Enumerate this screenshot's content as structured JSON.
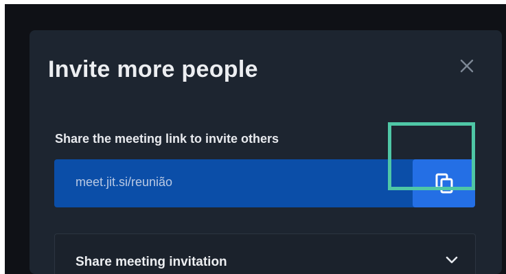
{
  "dialog": {
    "title": "Invite more people",
    "close_icon": "close-icon",
    "share_link": {
      "label": "Share the meeting link to invite others",
      "url": "meet.jit.si/reunião",
      "copy_icon": "copy-icon"
    },
    "invitation": {
      "label": "Share meeting invitation",
      "chevron_icon": "chevron-down-icon"
    }
  },
  "colors": {
    "background": "#0f1116",
    "dialog": "#1d2530",
    "link_box": "#0b4ea8",
    "copy_button": "#246fe5",
    "highlight": "#4fc7a6",
    "text": "#eceef1"
  }
}
